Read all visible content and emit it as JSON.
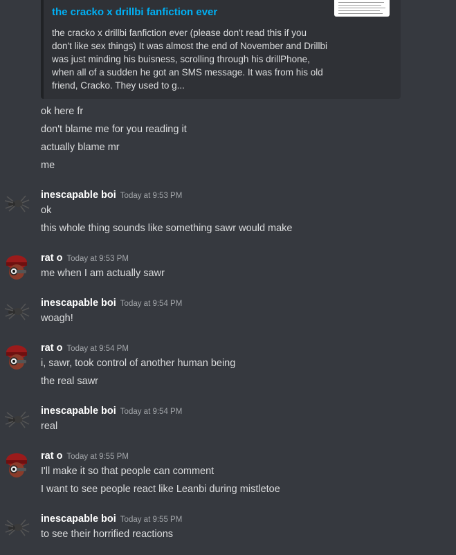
{
  "embed": {
    "title": "the cracko x drillbi fanfiction ever",
    "description": "the cracko x drillbi fanfiction ever (please don't read this if you don't like sex things) It was almost the end of November and Drillbi was just minding his buisness, scrolling through his drillPhone, when all of a sudden he got an SMS message. It was from his old friend, Cracko. They used to g..."
  },
  "continued_lines": [
    "ok here fr",
    "don't blame me for you reading it",
    "actually blame mr",
    "me"
  ],
  "messages": [
    {
      "author": "inescapable boi",
      "timestamp": "Today at 9:53 PM",
      "avatar": "spider-avatar",
      "lines": [
        "ok",
        "this whole thing sounds like something sawr would make"
      ]
    },
    {
      "author": "rat o",
      "timestamp": "Today at 9:53 PM",
      "avatar": "red-cap-avatar",
      "lines": [
        "me when I am actually sawr"
      ]
    },
    {
      "author": "inescapable boi",
      "timestamp": "Today at 9:54 PM",
      "avatar": "spider-avatar",
      "lines": [
        "woagh!"
      ]
    },
    {
      "author": "rat o",
      "timestamp": "Today at 9:54 PM",
      "avatar": "red-cap-avatar",
      "lines": [
        "i, sawr, took control of another human being",
        "the real sawr"
      ]
    },
    {
      "author": "inescapable boi",
      "timestamp": "Today at 9:54 PM",
      "avatar": "spider-avatar",
      "lines": [
        "real"
      ]
    },
    {
      "author": "rat o",
      "timestamp": "Today at 9:55 PM",
      "avatar": "red-cap-avatar",
      "lines": [
        "I'll make it so that people can comment",
        "I want to see people react like Leanbi during mistletoe"
      ]
    },
    {
      "author": "inescapable boi",
      "timestamp": "Today at 9:55 PM",
      "avatar": "spider-avatar",
      "lines": [
        "to see their horrified reactions"
      ]
    }
  ],
  "colors": {
    "background": "#36393f",
    "embed_bg": "#2f3136",
    "link": "#00b0f4",
    "text": "#dcddde",
    "timestamp": "#a3a6aa"
  }
}
